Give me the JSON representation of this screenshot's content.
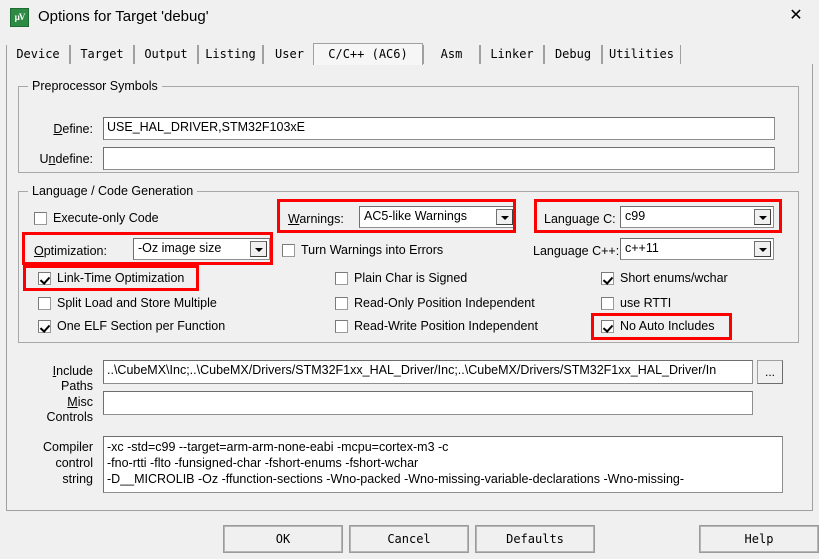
{
  "window": {
    "title": "Options for Target 'debug'",
    "icon": "uvision-logo-icon",
    "close_label": "✕"
  },
  "tabs": [
    {
      "label": "Device",
      "active": false
    },
    {
      "label": "Target",
      "active": false
    },
    {
      "label": "Output",
      "active": false
    },
    {
      "label": "Listing",
      "active": false
    },
    {
      "label": "User",
      "active": false
    },
    {
      "label": "C/C++ (AC6)",
      "active": true
    },
    {
      "label": "Asm",
      "active": false
    },
    {
      "label": "Linker",
      "active": false
    },
    {
      "label": "Debug",
      "active": false
    },
    {
      "label": "Utilities",
      "active": false
    }
  ],
  "preprocessor": {
    "group_title": "Preprocessor Symbols",
    "define_label": "Define:",
    "define_value": "USE_HAL_DRIVER,STM32F103xE",
    "undefine_label": "Undefine:",
    "undefine_value": ""
  },
  "language": {
    "group_title": "Language / Code Generation",
    "execute_only_code": {
      "label": "Execute-only Code",
      "checked": false
    },
    "optimization_label": "Optimization:",
    "optimization_value": "-Oz image size",
    "link_time_optimization": {
      "label": "Link-Time Optimization",
      "checked": true
    },
    "split_load_store": {
      "label": "Split Load and Store Multiple",
      "checked": false
    },
    "one_elf_section": {
      "label": "One ELF Section per Function",
      "checked": true
    },
    "warnings_label": "Warnings:",
    "warnings_value": "AC5-like Warnings",
    "turn_warnings_into_errors": {
      "label": "Turn Warnings into Errors",
      "checked": false
    },
    "plain_char_is_signed": {
      "label": "Plain Char is Signed",
      "checked": false
    },
    "read_only_position_independent": {
      "label": "Read-Only Position Independent",
      "checked": false
    },
    "read_write_position_independent": {
      "label": "Read-Write Position Independent",
      "checked": false
    },
    "language_c_label": "Language C:",
    "language_c_value": "c99",
    "language_cpp_label": "Language C++:",
    "language_cpp_value": "c++11",
    "short_enums_wchar": {
      "label": "Short enums/wchar",
      "checked": true
    },
    "use_rtti": {
      "label": "use RTTI",
      "checked": false
    },
    "no_auto_includes": {
      "label": "No Auto Includes",
      "checked": true
    }
  },
  "bottom_fields": {
    "include_paths_label_line1": "Include",
    "include_paths_label_line2": "Paths",
    "include_paths_value": "..\\CubeMX\\Inc;..\\CubeMX/Drivers/STM32F1xx_HAL_Driver/Inc;..\\CubeMX/Drivers/STM32F1xx_HAL_Driver/In",
    "browse_button_label": "...",
    "misc_controls_label_line1": "Misc",
    "misc_controls_label_line2": "Controls",
    "misc_controls_value": "",
    "compiler_label_line1": "Compiler",
    "compiler_label_line2": "control",
    "compiler_label_line3": "string",
    "compiler_value": "-xc -std=c99 --target=arm-arm-none-eabi -mcpu=cortex-m3 -c\n-fno-rtti -flto -funsigned-char -fshort-enums -fshort-wchar\n-D__MICROLIB -Oz -ffunction-sections -Wno-packed -Wno-missing-variable-declarations -Wno-missing-"
  },
  "buttons": {
    "ok": "OK",
    "cancel": "Cancel",
    "defaults": "Defaults",
    "help": "Help"
  },
  "annotations": {
    "highlight_color": "#ff0000",
    "boxes": [
      "optimization-highlight",
      "link-time-optimization-highlight",
      "warnings-highlight",
      "language-c-highlight",
      "no-auto-includes-highlight"
    ]
  }
}
